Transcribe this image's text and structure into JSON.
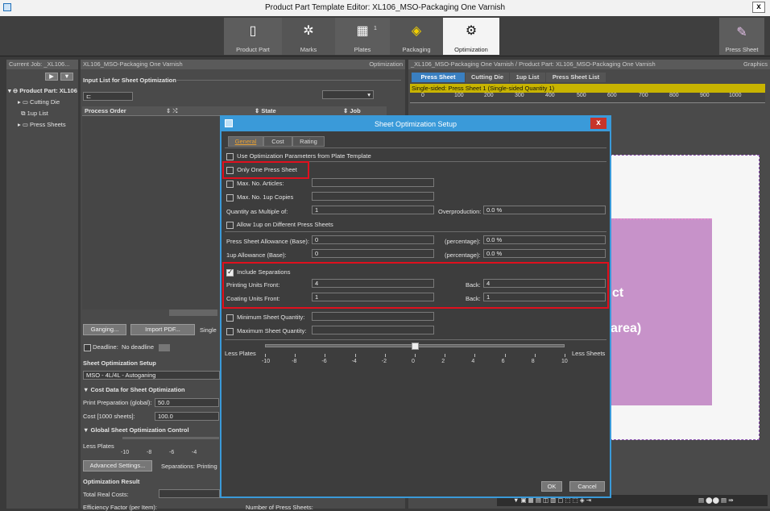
{
  "window": {
    "title": "Product Part Template Editor: XL106_MSO-Packaging One Varnish",
    "close": "x"
  },
  "workflow": {
    "steps": [
      {
        "label": "Product Part",
        "icon": "document-icon"
      },
      {
        "label": "Marks",
        "icon": "marks-icon"
      },
      {
        "label": "Plates",
        "icon": "plates-icon",
        "badge": "1"
      },
      {
        "label": "Packaging",
        "icon": "packaging-icon"
      },
      {
        "label": "Optimization",
        "icon": "gear-icon"
      }
    ],
    "press_sheet": "Press Sheet"
  },
  "left_panel": {
    "header": "Current Job: _XL106...",
    "tree": {
      "root": "Product Part: XL106",
      "children": [
        "Cutting Die",
        "1up List",
        "Press Sheets"
      ]
    }
  },
  "middle_panel": {
    "header": "XL106_MSO-Packaging One Varnish",
    "header_right": "Optimization",
    "input_list_title": "Input List for Sheet Optimization",
    "columns": [
      "Process Order",
      "State",
      "Job"
    ],
    "ganging_btn": "Ganging...",
    "import_pdf_btn": "Import PDF...",
    "single_label": "Single",
    "deadline_label": "Deadline:",
    "deadline_value": "No deadline",
    "sheet_opt_setup_title": "Sheet Optimization Setup",
    "sheet_opt_setup_value": "MSO - 4L/4L - Autoganing",
    "cost_data_title": "Cost Data for Sheet Optimization",
    "print_prep_label": "Print Preparation (global):",
    "print_prep_value": "50.0",
    "cost_label": "Cost [1000 sheets]:",
    "cost_value": "100.0",
    "global_ctrl_title": "Global Sheet Optimization Control",
    "less_plates": "Less Plates",
    "mini_ticks": [
      "-10",
      "-8",
      "-6",
      "-4"
    ],
    "advanced_btn": "Advanced Settings...",
    "separations_text": "Separations: Printing",
    "opt_result_title": "Optimization Result",
    "total_real_costs": "Total Real Costs:",
    "efficiency": "Efficiency Factor (per Item):",
    "num_press_sheets": "Number of Press Sheets:"
  },
  "right_panel": {
    "header": "_XL106_MSO-Packaging One Varnish / Product Part: XL106_MSO-Packaging One Varnish",
    "header_right": "Graphics",
    "tabs": [
      "Press Sheet",
      "Cutting Die",
      "1up List",
      "Press Sheet List"
    ],
    "status": "Single-sided:  Press Sheet 1 (Single-sided Quantity 1)",
    "ruler": [
      "0",
      "100",
      "200",
      "300",
      "400",
      "500",
      "600",
      "700",
      "800",
      "900",
      "1000"
    ],
    "canvas_text_1": "ct",
    "canvas_text_2": "area)"
  },
  "dialog": {
    "title": "Sheet Optimization Setup",
    "close": "x",
    "tabs": [
      "General",
      "Cost",
      "Rating"
    ],
    "use_plate_template": "Use Optimization Parameters from Plate Template",
    "only_one_press_sheet": "Only One Press Sheet",
    "max_articles": "Max. No. Articles:",
    "max_1up": "Max. No. 1up Copies",
    "qty_multiple_label": "Quantity as Multiple of:",
    "qty_multiple_value": "1",
    "overproduction_label": "Overproduction:",
    "overproduction_value": "0.0 %",
    "allow_1up": "Allow 1up on Different Press Sheets",
    "press_allow_label": "Press Sheet Allowance (Base):",
    "press_allow_value": "0",
    "percentage_label": "(percentage):",
    "press_allow_pct": "0.0 %",
    "oneup_allow_label": "1up Allowance (Base):",
    "oneup_allow_value": "0",
    "oneup_allow_pct": "0.0 %",
    "include_separations": "Include Separations",
    "printing_units_label": "Printing Units Front:",
    "printing_units_front": "4",
    "back_label": "Back:",
    "printing_units_back": "4",
    "coating_units_label": "Coating Units Front:",
    "coating_units_front": "1",
    "coating_units_back": "1",
    "min_sheet_qty": "Minimum Sheet Quantity:",
    "max_sheet_qty": "Maximum Sheet Quantity:",
    "less_plates": "Less Plates",
    "less_sheets": "Less Sheets",
    "slider_ticks": [
      "-10",
      "-8",
      "-6",
      "-4",
      "-2",
      "0",
      "2",
      "4",
      "6",
      "8",
      "10"
    ],
    "slider_value": 0,
    "ok": "OK",
    "cancel": "Cancel"
  },
  "colors": {
    "accent": "#3a9ad9",
    "highlight": "#e0101e",
    "status_bar": "#c8b400",
    "canvas_purple": "#c792c9"
  }
}
